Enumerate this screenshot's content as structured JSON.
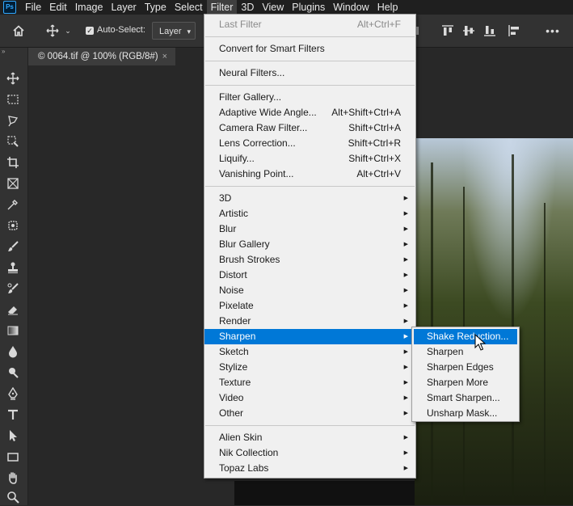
{
  "app": {
    "logo": "Ps"
  },
  "menubar": {
    "items": [
      "File",
      "Edit",
      "Image",
      "Layer",
      "Type",
      "Select",
      "Filter",
      "3D",
      "View",
      "Plugins",
      "Window",
      "Help"
    ],
    "active": "Filter"
  },
  "options_bar": {
    "auto_select_label": "Auto-Select:",
    "auto_select_checked": true,
    "layer_select_value": "Layer"
  },
  "document": {
    "tab_title": "© 0064.tif @ 100% (RGB/8#)",
    "tab_close": "×"
  },
  "filter_menu": {
    "items": [
      {
        "label": "Last Filter",
        "shortcut": "Alt+Ctrl+F",
        "disabled": true
      },
      {
        "separator": true
      },
      {
        "label": "Convert for Smart Filters"
      },
      {
        "separator": true
      },
      {
        "label": "Neural Filters..."
      },
      {
        "separator": true
      },
      {
        "label": "Filter Gallery..."
      },
      {
        "label": "Adaptive Wide Angle...",
        "shortcut": "Alt+Shift+Ctrl+A"
      },
      {
        "label": "Camera Raw Filter...",
        "shortcut": "Shift+Ctrl+A"
      },
      {
        "label": "Lens Correction...",
        "shortcut": "Shift+Ctrl+R"
      },
      {
        "label": "Liquify...",
        "shortcut": "Shift+Ctrl+X"
      },
      {
        "label": "Vanishing Point...",
        "shortcut": "Alt+Ctrl+V"
      },
      {
        "separator": true
      },
      {
        "label": "3D",
        "submenu": true
      },
      {
        "label": "Artistic",
        "submenu": true
      },
      {
        "label": "Blur",
        "submenu": true
      },
      {
        "label": "Blur Gallery",
        "submenu": true
      },
      {
        "label": "Brush Strokes",
        "submenu": true
      },
      {
        "label": "Distort",
        "submenu": true
      },
      {
        "label": "Noise",
        "submenu": true
      },
      {
        "label": "Pixelate",
        "submenu": true
      },
      {
        "label": "Render",
        "submenu": true
      },
      {
        "label": "Sharpen",
        "submenu": true,
        "highlighted": true
      },
      {
        "label": "Sketch",
        "submenu": true
      },
      {
        "label": "Stylize",
        "submenu": true
      },
      {
        "label": "Texture",
        "submenu": true
      },
      {
        "label": "Video",
        "submenu": true
      },
      {
        "label": "Other",
        "submenu": true
      },
      {
        "separator": true
      },
      {
        "label": "Alien Skin",
        "submenu": true
      },
      {
        "label": "Nik Collection",
        "submenu": true
      },
      {
        "label": "Topaz Labs",
        "submenu": true
      }
    ]
  },
  "sharpen_submenu": {
    "items": [
      {
        "label": "Shake Reduction...",
        "highlighted": true
      },
      {
        "label": "Sharpen"
      },
      {
        "label": "Sharpen Edges"
      },
      {
        "label": "Sharpen More"
      },
      {
        "label": "Smart Sharpen..."
      },
      {
        "label": "Unsharp Mask..."
      }
    ]
  },
  "colors": {
    "highlight": "#0078d7",
    "menu_bg": "#f0f0f0",
    "app_bg": "#282828"
  }
}
